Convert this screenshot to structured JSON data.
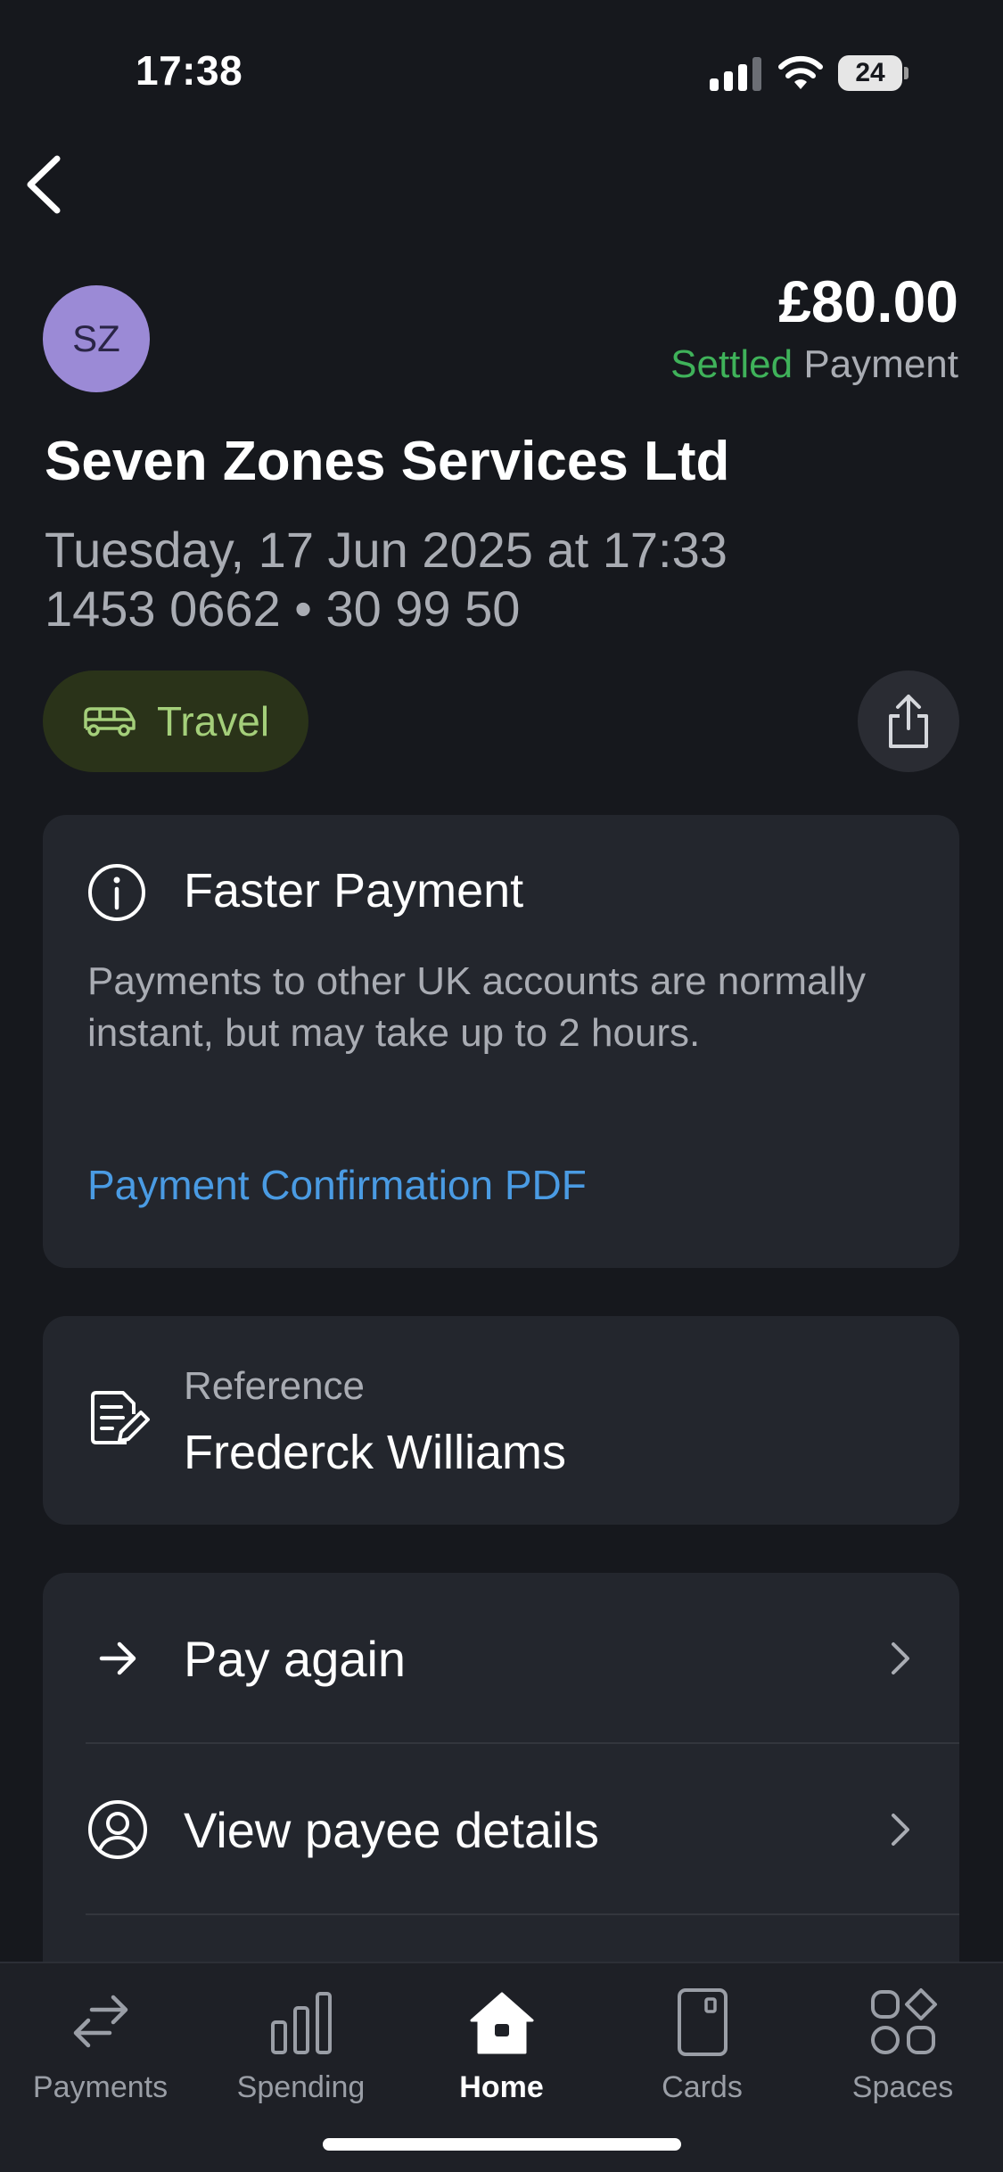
{
  "status_bar": {
    "time": "17:38",
    "battery": "24"
  },
  "header": {
    "avatar_initials": "SZ",
    "amount": "£80.00",
    "status": "Settled",
    "payment_type": "Payment",
    "merchant": "Seven Zones Services Ltd",
    "datetime": "Tuesday, 17 Jun 2025 at 17:33",
    "account_info": "1453 0662 • 30 99 50",
    "category": "Travel"
  },
  "info_card": {
    "title": "Faster Payment",
    "body": "Payments to other UK accounts are normally instant, but may take up to 2 hours.",
    "link": "Payment Confirmation PDF"
  },
  "reference_card": {
    "label": "Reference",
    "value": "Frederck Williams"
  },
  "actions": [
    {
      "label": "Pay again"
    },
    {
      "label": "View payee details"
    }
  ],
  "tabbar": [
    {
      "label": "Payments"
    },
    {
      "label": "Spending"
    },
    {
      "label": "Home"
    },
    {
      "label": "Cards"
    },
    {
      "label": "Spaces"
    }
  ],
  "colors": {
    "background": "#16181d",
    "card": "#23262d",
    "settled_green": "#3fb25a",
    "link_blue": "#4a9be3",
    "avatar": "#9b8ad6",
    "travel_chip": "#2a3319"
  },
  "active_tab": "Home"
}
